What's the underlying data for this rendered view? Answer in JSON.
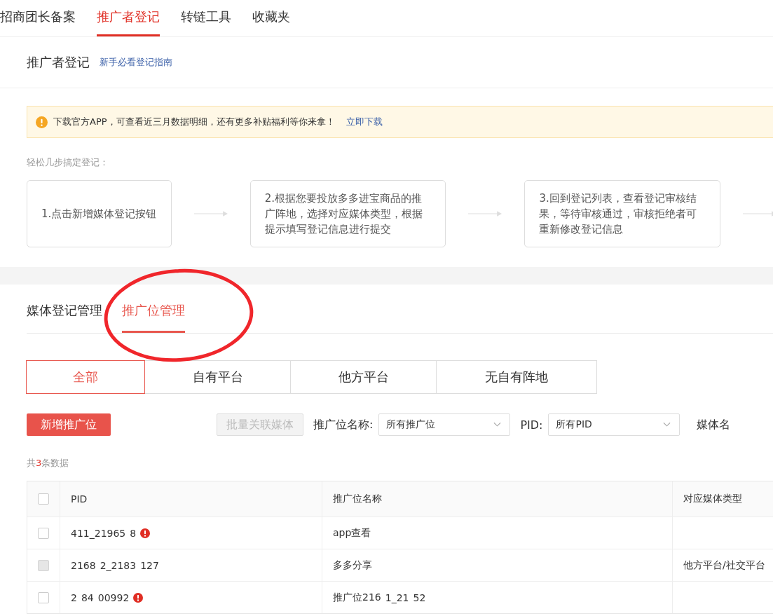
{
  "top_tabs": [
    {
      "label": "招商团长备案",
      "selected": false
    },
    {
      "label": "推广者登记",
      "selected": true
    },
    {
      "label": "转链工具",
      "selected": false
    },
    {
      "label": "收藏夹",
      "selected": false
    }
  ],
  "register": {
    "title": "推广者登记",
    "guide_link": "新手必看登记指南",
    "notice": {
      "text": "下载官方APP，可查看近三月数据明细，还有更多补贴福利等你来拿！",
      "link": "立即下载"
    },
    "steps_label": "轻松几步搞定登记：",
    "steps": [
      "1.点击新增媒体登记按钮",
      "2.根据您要投放多多进宝商品的推广阵地，选择对应媒体类型，根据提示填写登记信息进行提交",
      "3.回到登记列表，查看登记审核结果，等待审核通过，审核拒绝者可重新修改登记信息"
    ]
  },
  "manage": {
    "tabs": [
      {
        "label": "媒体登记管理",
        "selected": false
      },
      {
        "label": "推广位管理",
        "selected": true
      }
    ],
    "segments": [
      {
        "label": "全部",
        "selected": true
      },
      {
        "label": "自有平台",
        "selected": false
      },
      {
        "label": "他方平台",
        "selected": false
      },
      {
        "label": "无自有阵地",
        "selected": false
      }
    ],
    "add_button": "新增推广位",
    "batch_button": {
      "label": "批量关联媒体",
      "disabled": true
    },
    "filters": [
      {
        "label": "推广位名称:",
        "value": "所有推广位"
      },
      {
        "label": "PID:",
        "value": "所有PID"
      }
    ],
    "cut_filter_label": "媒体名",
    "count": {
      "prefix": "共",
      "number": "3",
      "suffix": "条数据"
    },
    "table": {
      "select_all_checked": false,
      "columns": [
        "PID",
        "推广位名称",
        "对应媒体类型"
      ],
      "rows": [
        {
          "pid": [
            "411_21965",
            "8"
          ],
          "warning": true,
          "checked": false,
          "disabled": false,
          "name": [
            "app查看"
          ],
          "media_type": ""
        },
        {
          "pid": [
            "2168",
            "2_2183",
            "127"
          ],
          "warning": false,
          "checked": false,
          "disabled": true,
          "name": [
            "多多分享"
          ],
          "media_type": "他方平台/社交平台"
        },
        {
          "pid": [
            "2",
            "84",
            "00992"
          ],
          "warning": true,
          "checked": false,
          "disabled": false,
          "name": [
            "推广位216",
            "1_21",
            "52"
          ],
          "media_type": ""
        }
      ]
    }
  }
}
